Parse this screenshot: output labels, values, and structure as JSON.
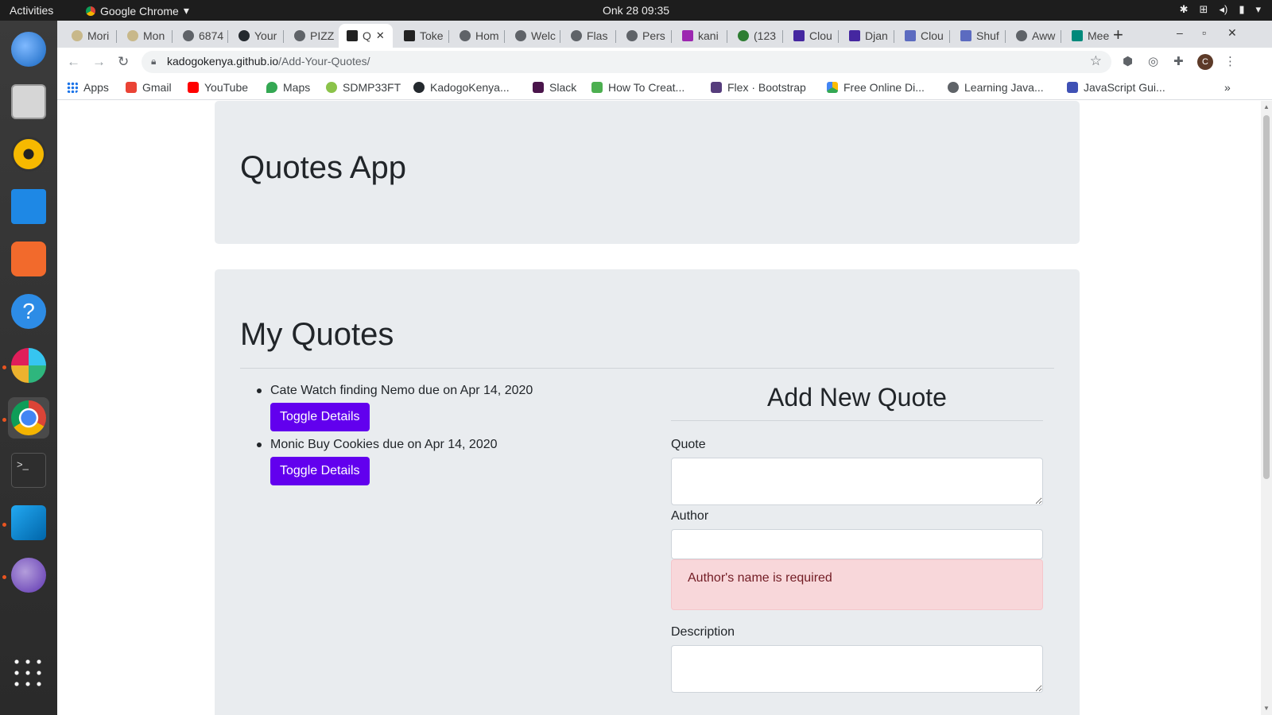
{
  "system": {
    "activities": "Activities",
    "app_name": "Google Chrome",
    "clock": "Onk 28  09:35"
  },
  "browser": {
    "tabs": [
      {
        "label": "Mori"
      },
      {
        "label": "Mon"
      },
      {
        "label": "6874"
      },
      {
        "label": "Your"
      },
      {
        "label": "PIZZ"
      },
      {
        "label": "Q",
        "active": true
      },
      {
        "label": "Toke"
      },
      {
        "label": "Hom"
      },
      {
        "label": "Welc"
      },
      {
        "label": "Flas"
      },
      {
        "label": "Pers"
      },
      {
        "label": "kani"
      },
      {
        "label": "(123"
      },
      {
        "label": "Clou"
      },
      {
        "label": "Djan"
      },
      {
        "label": "Clou"
      },
      {
        "label": "Shuf"
      },
      {
        "label": "Aww"
      },
      {
        "label": "Mee"
      }
    ],
    "url_host": "kadogokenya.github.io",
    "url_path": "/Add-Your-Quotes/",
    "profile_initial": "C",
    "bookmarks": [
      {
        "label": "Apps",
        "color": "#1a73e8"
      },
      {
        "label": "Gmail",
        "color": "#ea4335"
      },
      {
        "label": "YouTube",
        "color": "#ff0000"
      },
      {
        "label": "Maps",
        "color": "#34a853"
      },
      {
        "label": "SDMP33FT",
        "color": "#8bc34a"
      },
      {
        "label": "KadogoKenya...",
        "color": "#24292e"
      },
      {
        "label": "Slack",
        "color": "#4a154b"
      },
      {
        "label": "How To Creat...",
        "color": "#4caf50"
      },
      {
        "label": "Flex · Bootstrap",
        "color": "#563d7c"
      },
      {
        "label": "Free Online Di...",
        "color": "#fbbc04"
      },
      {
        "label": "Learning Java...",
        "color": "#5f6368"
      },
      {
        "label": "JavaScript Gui...",
        "color": "#3f51b5"
      }
    ]
  },
  "page": {
    "app_title": "Quotes App",
    "list_title": "My Quotes",
    "quotes": [
      {
        "text": "Cate Watch finding Nemo due on Apr 14, 2020",
        "button": "Toggle Details"
      },
      {
        "text": "Monic Buy Cookies due on Apr 14, 2020",
        "button": "Toggle Details"
      }
    ],
    "form": {
      "title": "Add New Quote",
      "quote_label": "Quote",
      "author_label": "Author",
      "author_error": "Author's name is required",
      "description_label": "Description"
    }
  }
}
